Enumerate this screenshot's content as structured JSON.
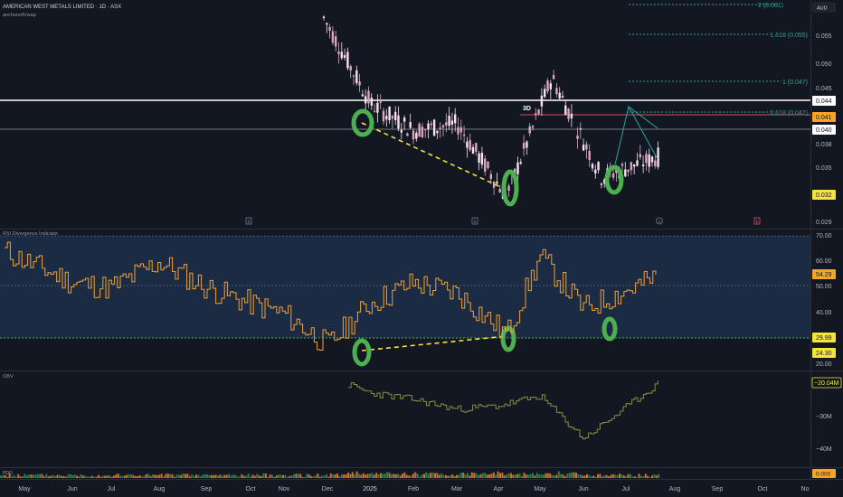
{
  "header": {
    "title": "AMERICAN WEST METALS LIMITED · 1D · ASX",
    "subtitle": "anchoredVwap"
  },
  "currency": "AUD",
  "markers": {
    "session_box": "3D"
  },
  "colors": {
    "background": "#131722",
    "up": "#f7e0ea",
    "down": "#d9a7c0",
    "rsi_line": "#f0a030",
    "rsi_band": "#1c2b44",
    "obv_line": "#8a8f3a",
    "fib": "#26a69a",
    "divergence_line": "#f5e43a",
    "highlight_circle": "#4caf50",
    "resistance_line": "#ffffff",
    "red_level": "#e04a5a"
  },
  "price_pane": {
    "axis_ticks": [
      "0.055",
      "0.050",
      "0.045",
      "0.040",
      "0.038",
      "0.035",
      "0.029"
    ],
    "fib_levels": [
      {
        "label": "2 (0.061)",
        "value": 0.061
      },
      {
        "label": "1.618 (0.055)",
        "value": 0.055
      },
      {
        "label": "1 (0.047)",
        "value": 0.047
      },
      {
        "label": "0.618 (0.042)",
        "value": 0.042
      }
    ],
    "tags": [
      {
        "text": "0.044",
        "bg": "#ffffff",
        "fg": "#131722"
      },
      {
        "text": "0.041",
        "bg": "#f5a623",
        "fg": "#131722"
      },
      {
        "text": "0.040",
        "bg": "#ffffff",
        "fg": "#131722"
      },
      {
        "text": "0.032",
        "bg": "#f5e43a",
        "fg": "#131722"
      }
    ],
    "event_icons": [
      "E",
      "E",
      "D",
      "E"
    ]
  },
  "rsi_pane": {
    "title": "RSI Divergence Indicator",
    "axis_ticks": [
      "70.00",
      "60.00",
      "50.00",
      "40.00",
      "20.00"
    ],
    "tags": [
      {
        "text": "54.29",
        "bg": "#f5a623",
        "fg": "#131722"
      },
      {
        "text": "29.99",
        "bg": "#f5e43a",
        "fg": "#131722"
      },
      {
        "text": "24.30",
        "bg": "#f5e43a",
        "fg": "#131722"
      }
    ]
  },
  "obv_pane": {
    "title": "OBV",
    "axis_ticks": [
      "−30M",
      "−40M"
    ],
    "tag": "−20.04M"
  },
  "volume_pane": {
    "title": "PDO",
    "tag": "0.000"
  },
  "time_axis": [
    "May",
    "Jun",
    "Jul",
    "Aug",
    "Sep",
    "Oct",
    "Nov",
    "Dec",
    "2025",
    "Feb",
    "Mar",
    "Apr",
    "May",
    "Jun",
    "Jul",
    "Aug",
    "Sep",
    "Oct",
    "No"
  ],
  "chart_data": [
    {
      "type": "line",
      "title": "AMERICAN WEST METALS LIMITED · 1D · ASX",
      "x": [
        "Dec",
        "Jan",
        "Feb",
        "Mar",
        "Apr",
        "May",
        "Jun",
        "Jul"
      ],
      "series": [
        {
          "values": [
            0.06,
            0.047,
            0.043,
            0.044,
            0.033,
            0.051,
            0.036,
            0.039
          ]
        }
      ],
      "ylim": [
        0.029,
        0.063
      ]
    },
    {
      "type": "line",
      "title": "RSI Divergence Indicator",
      "x": [
        "May",
        "Jun",
        "Jul",
        "Aug",
        "Sep",
        "Oct",
        "Nov",
        "Dec",
        "2025",
        "Feb",
        "Mar",
        "Apr",
        "May",
        "Jun",
        "Jul"
      ],
      "series": [
        {
          "values": [
            64,
            52,
            50,
            60,
            50,
            44,
            40,
            28,
            44,
            52,
            48,
            32,
            62,
            42,
            54.29
          ]
        }
      ],
      "ylim": [
        20,
        70
      ]
    },
    {
      "type": "line",
      "title": "OBV",
      "x": [
        "Dec",
        "2025",
        "Feb",
        "Mar",
        "Apr",
        "May",
        "Jun",
        "Jul"
      ],
      "series": [
        {
          "values": [
            -20.5,
            -23,
            -25,
            -28,
            -27,
            -24,
            -37,
            -20.04
          ]
        }
      ]
    }
  ]
}
